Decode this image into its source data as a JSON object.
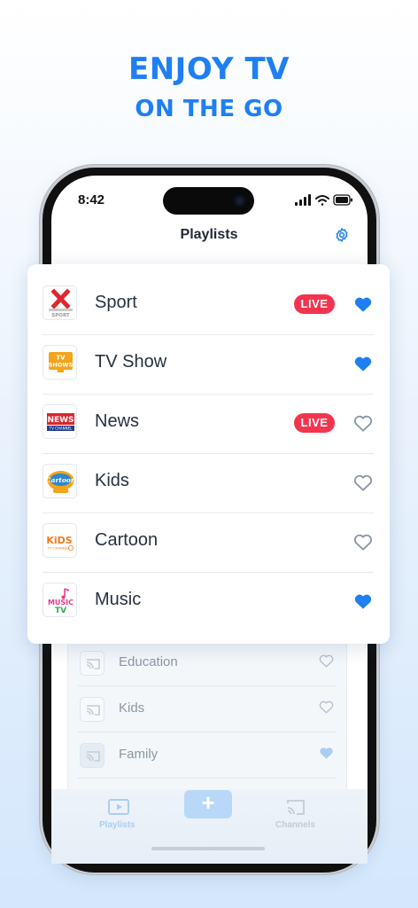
{
  "headline": "ENJOY TV",
  "subheadline": "ON THE GO",
  "status_bar": {
    "time": "8:42"
  },
  "screen_title": "Playlists",
  "playlists": [
    {
      "label": "Sport",
      "live": "LIVE",
      "favorite": true,
      "thumb": "sport-logo"
    },
    {
      "label": "TV Show",
      "live": "",
      "favorite": true,
      "thumb": "tv-shows-logo"
    },
    {
      "label": "News",
      "live": "LIVE",
      "favorite": false,
      "thumb": "news-logo"
    },
    {
      "label": "Kids",
      "live": "",
      "favorite": false,
      "thumb": "cartoon-logo"
    },
    {
      "label": "Cartoon",
      "live": "",
      "favorite": false,
      "thumb": "kids-tv-logo"
    },
    {
      "label": "Music",
      "live": "",
      "favorite": true,
      "thumb": "music-tv-logo"
    }
  ],
  "background_list": [
    {
      "label": "Education",
      "favorite": false
    },
    {
      "label": "Kids",
      "favorite": false
    },
    {
      "label": "Family",
      "favorite": true
    }
  ],
  "tabbar": {
    "playlists_label": "Playlists",
    "channels_label": "Channels",
    "add_label": "+"
  },
  "colors": {
    "accent": "#1e7ff2",
    "live": "#f4344f",
    "heart_filled": "#1e7ff2",
    "heart_outline": "#8a96a6"
  },
  "thumb_text": {
    "sport": "SPORT",
    "tv_shows_top": "TV",
    "tv_shows_bottom": "SHOWS",
    "news": "NEWS",
    "news_sub": "TV CHANNEL",
    "cartoon": "Cartoon",
    "kids_top": "KiDS",
    "kids_sub": "TV CHANNEL",
    "music_top": "MUSIC",
    "music_bottom": "TV"
  }
}
